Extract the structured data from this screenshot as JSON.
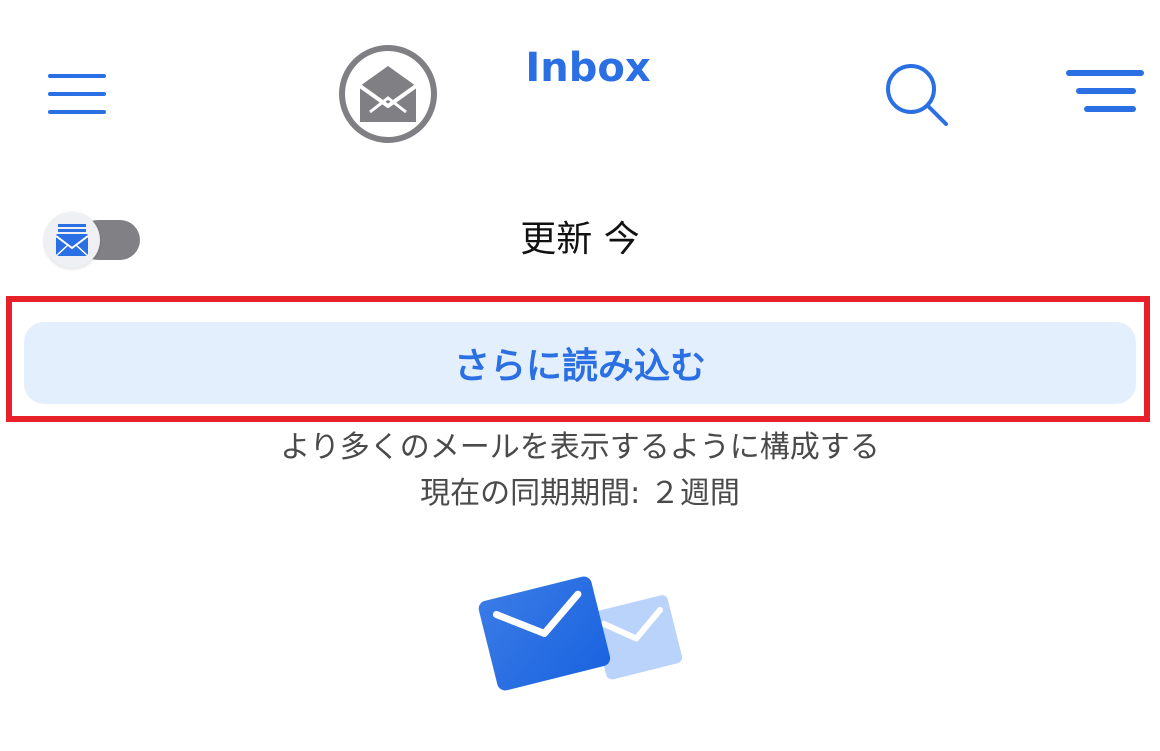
{
  "header": {
    "title": "Inbox",
    "icons": {
      "menu": "hamburger-menu-icon",
      "logo": "envelope-logo-icon",
      "search": "search-icon",
      "filter": "filter-icon"
    }
  },
  "sync": {
    "update_text": "更新 今",
    "toggle_on": false
  },
  "load_more": {
    "label": "さらに読み込む",
    "hint_line1": "より多くのメールを表示するように構成する",
    "hint_line2": "現在の同期期間: ２週間"
  },
  "colors": {
    "accent": "#2a6fe3",
    "button_bg": "#e3effc",
    "highlight": "#e8202a",
    "toggle_track": "#808085",
    "logo_gray": "#7f7f84"
  }
}
